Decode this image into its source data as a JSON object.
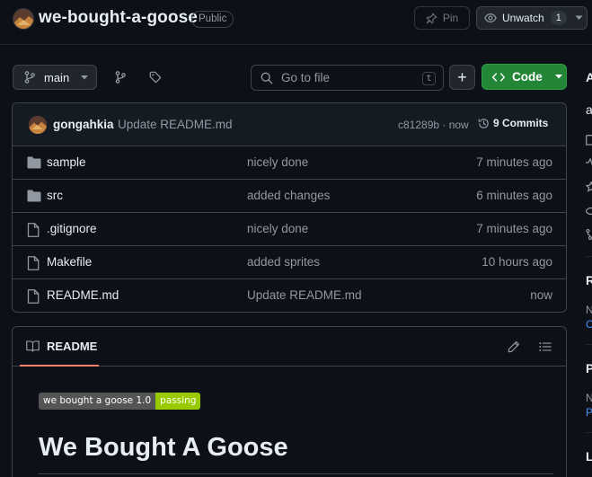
{
  "repo": {
    "name": "we-bought-a-goose",
    "visibility": "Public"
  },
  "header_actions": {
    "pin_label": "Pin",
    "watch_label": "Unwatch",
    "watch_count": "1"
  },
  "toolbar": {
    "branch": "main",
    "search_placeholder": "Go to file",
    "search_shortcut": "t",
    "add_label": "+",
    "code_label": "Code"
  },
  "latest_commit": {
    "author": "gongahkia",
    "message": "Update README.md",
    "meta": "c81289b · now",
    "commits_label": "9 Commits"
  },
  "files": [
    {
      "type": "folder",
      "name": "sample",
      "message": "nicely done",
      "time": "7 minutes ago"
    },
    {
      "type": "folder",
      "name": "src",
      "message": "added changes",
      "time": "6 minutes ago"
    },
    {
      "type": "file",
      "name": ".gitignore",
      "message": "nicely done",
      "time": "7 minutes ago"
    },
    {
      "type": "file",
      "name": "Makefile",
      "message": "added sprites",
      "time": "10 hours ago"
    },
    {
      "type": "file",
      "name": "README.md",
      "message": "Update README.md",
      "time": "now"
    }
  ],
  "readme": {
    "tab_label": "README",
    "badge_left": "we bought a goose 1.0",
    "badge_right": "passing",
    "heading": "We Bought A Goose"
  },
  "sidebar_clipped": {
    "about_initial": "A",
    "desc_initial": "a",
    "releases_initial": "R",
    "releases_note_initial": "N",
    "releases_link_initial": "C",
    "packages_initial": "P",
    "packages_note_initial": "N",
    "packages_link_initial": "P",
    "languages_initial": "L"
  },
  "colors": {
    "background": "#0d1117",
    "accent_green": "#238636",
    "link_blue": "#4493f8",
    "tab_underline": "#f78166",
    "badge_green": "#97ca00"
  }
}
